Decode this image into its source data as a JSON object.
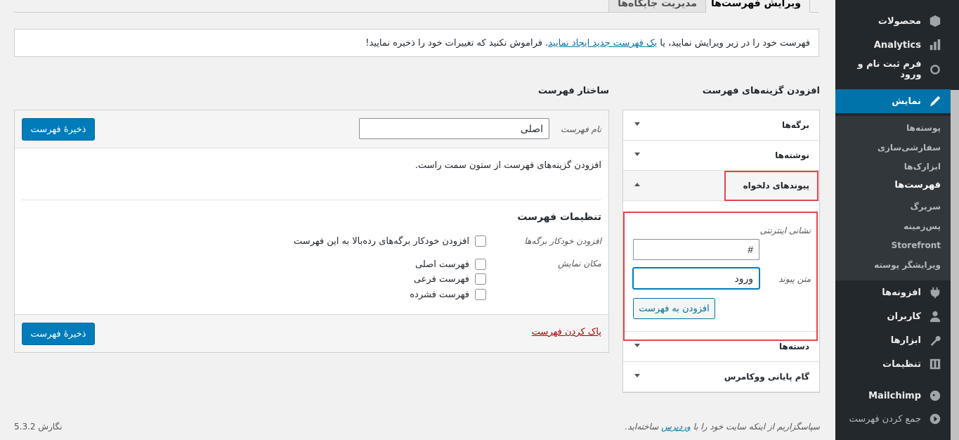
{
  "tabs": [
    {
      "label": "ویرایش فهرست‌ها",
      "active": true
    },
    {
      "label": "مدیریت جایگاه‌ها",
      "active": false
    }
  ],
  "notice": {
    "before": "فهرست خود را در زیر ویرایش نمایید، یا",
    "link": "یک فهرست جدید ایجاد نمایید",
    "after": ". فراموش نکنید که تغییرات خود را ذخیره نمایید!"
  },
  "add_items": {
    "heading": "افزودن گزینه‌های فهرست",
    "sections": [
      {
        "label": "برگه‌ها"
      },
      {
        "label": "نوشته‌ها"
      },
      {
        "label": "پیوندهای دلخواه"
      },
      {
        "label": "دسته‌ها"
      },
      {
        "label": "گام پایانی ووکامرس"
      }
    ],
    "custom_links": {
      "url_label": "نشانی اینترنتی",
      "url_value": "#",
      "text_label": "متن پیوند",
      "text_value": "ورود",
      "add_button": "افزودن به فهرست"
    }
  },
  "structure": {
    "heading": "ساختار فهرست",
    "name_label": "نام فهرست",
    "name_value": "اصلی",
    "save_button": "ذخیرهٔ فهرست",
    "empty_hint": "افزودن گزینه‌های فهرست از ستون سمت راست.",
    "settings_heading": "تنظیمات فهرست",
    "auto_add_label": "افزودن خودکار برگه‌ها",
    "auto_add_option": "افزودن خودکار برگه‌های رده‌بالا به این فهرست",
    "location_label": "مکان نمایش",
    "locations": [
      "فهرست اصلی",
      "فهرست فرعی",
      "فهرست فشرده"
    ],
    "delete_link": "پاک کردن فهرست"
  },
  "footer": {
    "thanks_before": "سپاسگزاریم از اینکه سایت خود را با",
    "thanks_link": "وردپرس",
    "thanks_after": "ساخته‌اید.",
    "version": "نگارش 5.3.2"
  },
  "sidebar": {
    "items": [
      {
        "label": "محصولات",
        "icon": "box-icon"
      },
      {
        "label": "Analytics",
        "icon": "bar-chart-icon"
      },
      {
        "label": "فرم ثبت نام و ورود",
        "icon": "form-icon"
      },
      {
        "label": "نمایش",
        "icon": "brush-icon"
      },
      {
        "label": "افزونه‌ها",
        "icon": "plug-icon"
      },
      {
        "label": "کاربران",
        "icon": "user-icon"
      },
      {
        "label": "ابزارها",
        "icon": "wrench-icon"
      },
      {
        "label": "تنظیمات",
        "icon": "settings-icon"
      },
      {
        "label": "Mailchimp",
        "icon": "mailchimp-icon"
      },
      {
        "label": "جمع کردن فهرست",
        "icon": "collapse-icon"
      }
    ],
    "submenu": [
      "پوسته‌ها",
      "سفارشی‌سازی",
      "ابزارک‌ها",
      "فهرست‌ها",
      "سربرگ",
      "پس‌زمینه",
      "Storefront",
      "ویرایشگر پوسته"
    ]
  }
}
